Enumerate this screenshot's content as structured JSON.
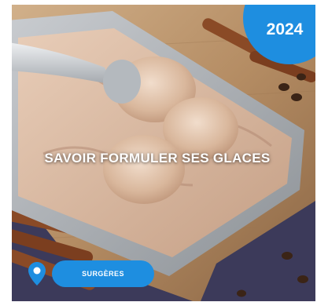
{
  "card": {
    "title": "SAVOIR FORMULER SES GLACES",
    "year": "2024",
    "location": "SURGÈRES",
    "image_subject": "chocolate ice cream in a metal tray with scoop, cinnamon sticks and coffee beans"
  },
  "colors": {
    "accent": "#1e8ee0",
    "text": "#ffffff"
  },
  "icons": {
    "location": "map-pin-icon"
  }
}
